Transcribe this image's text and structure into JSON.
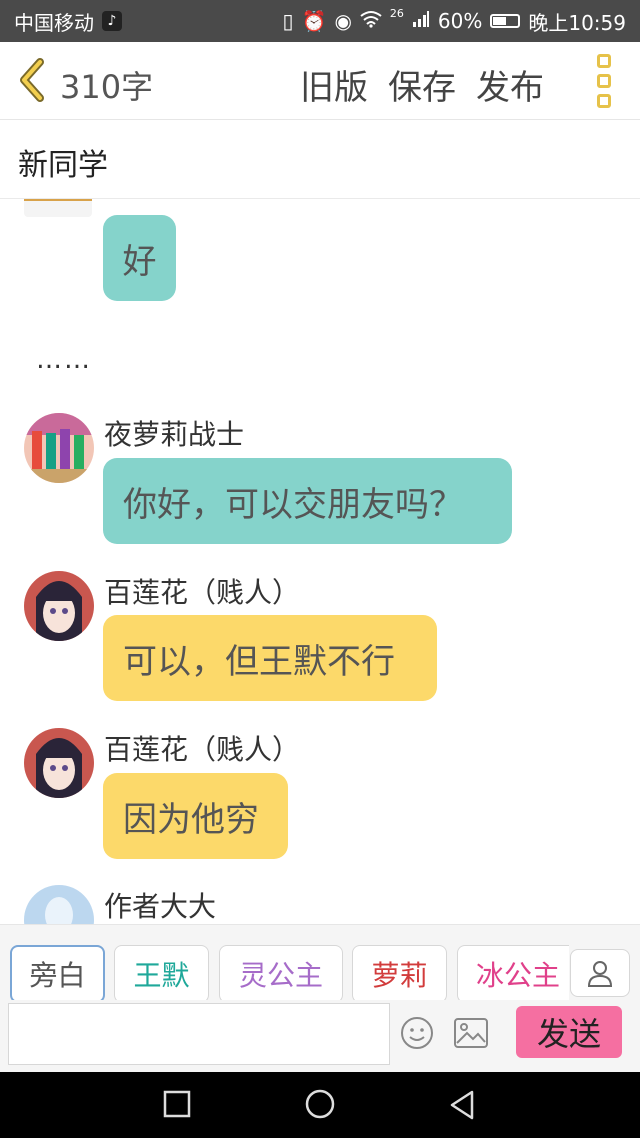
{
  "status_bar": {
    "carrier": "中国移动",
    "network": "26",
    "battery": "60%",
    "battery_level": 0.6,
    "time": "晚上10:59"
  },
  "toolbar": {
    "word_count": "310字",
    "old_version": "旧版",
    "save": "保存",
    "publish": "发布"
  },
  "chapter": {
    "title": "新同学"
  },
  "chat": {
    "messages": [
      {
        "text": "好",
        "color": "#85d3cb"
      },
      {
        "text": "……"
      },
      {
        "name": "夜萝莉战士",
        "text": "你好，可以交朋友吗？",
        "color": "#85d3cb"
      },
      {
        "name": "百莲花（贱人）",
        "text": "可以，但王默不行",
        "color": "#fcd96a"
      },
      {
        "name": "百莲花（贱人）",
        "text": "因为他穷",
        "color": "#fcd96a"
      },
      {
        "name": "作者大大"
      }
    ]
  },
  "characters": [
    {
      "label": "旁白",
      "color": "#555555"
    },
    {
      "label": "王默",
      "color": "#1fa89a"
    },
    {
      "label": "灵公主",
      "color": "#a66cc9"
    },
    {
      "label": "萝莉",
      "color": "#d23c3c"
    },
    {
      "label": "冰公主",
      "color": "#e0408a"
    }
  ],
  "compose": {
    "send": "发送"
  }
}
